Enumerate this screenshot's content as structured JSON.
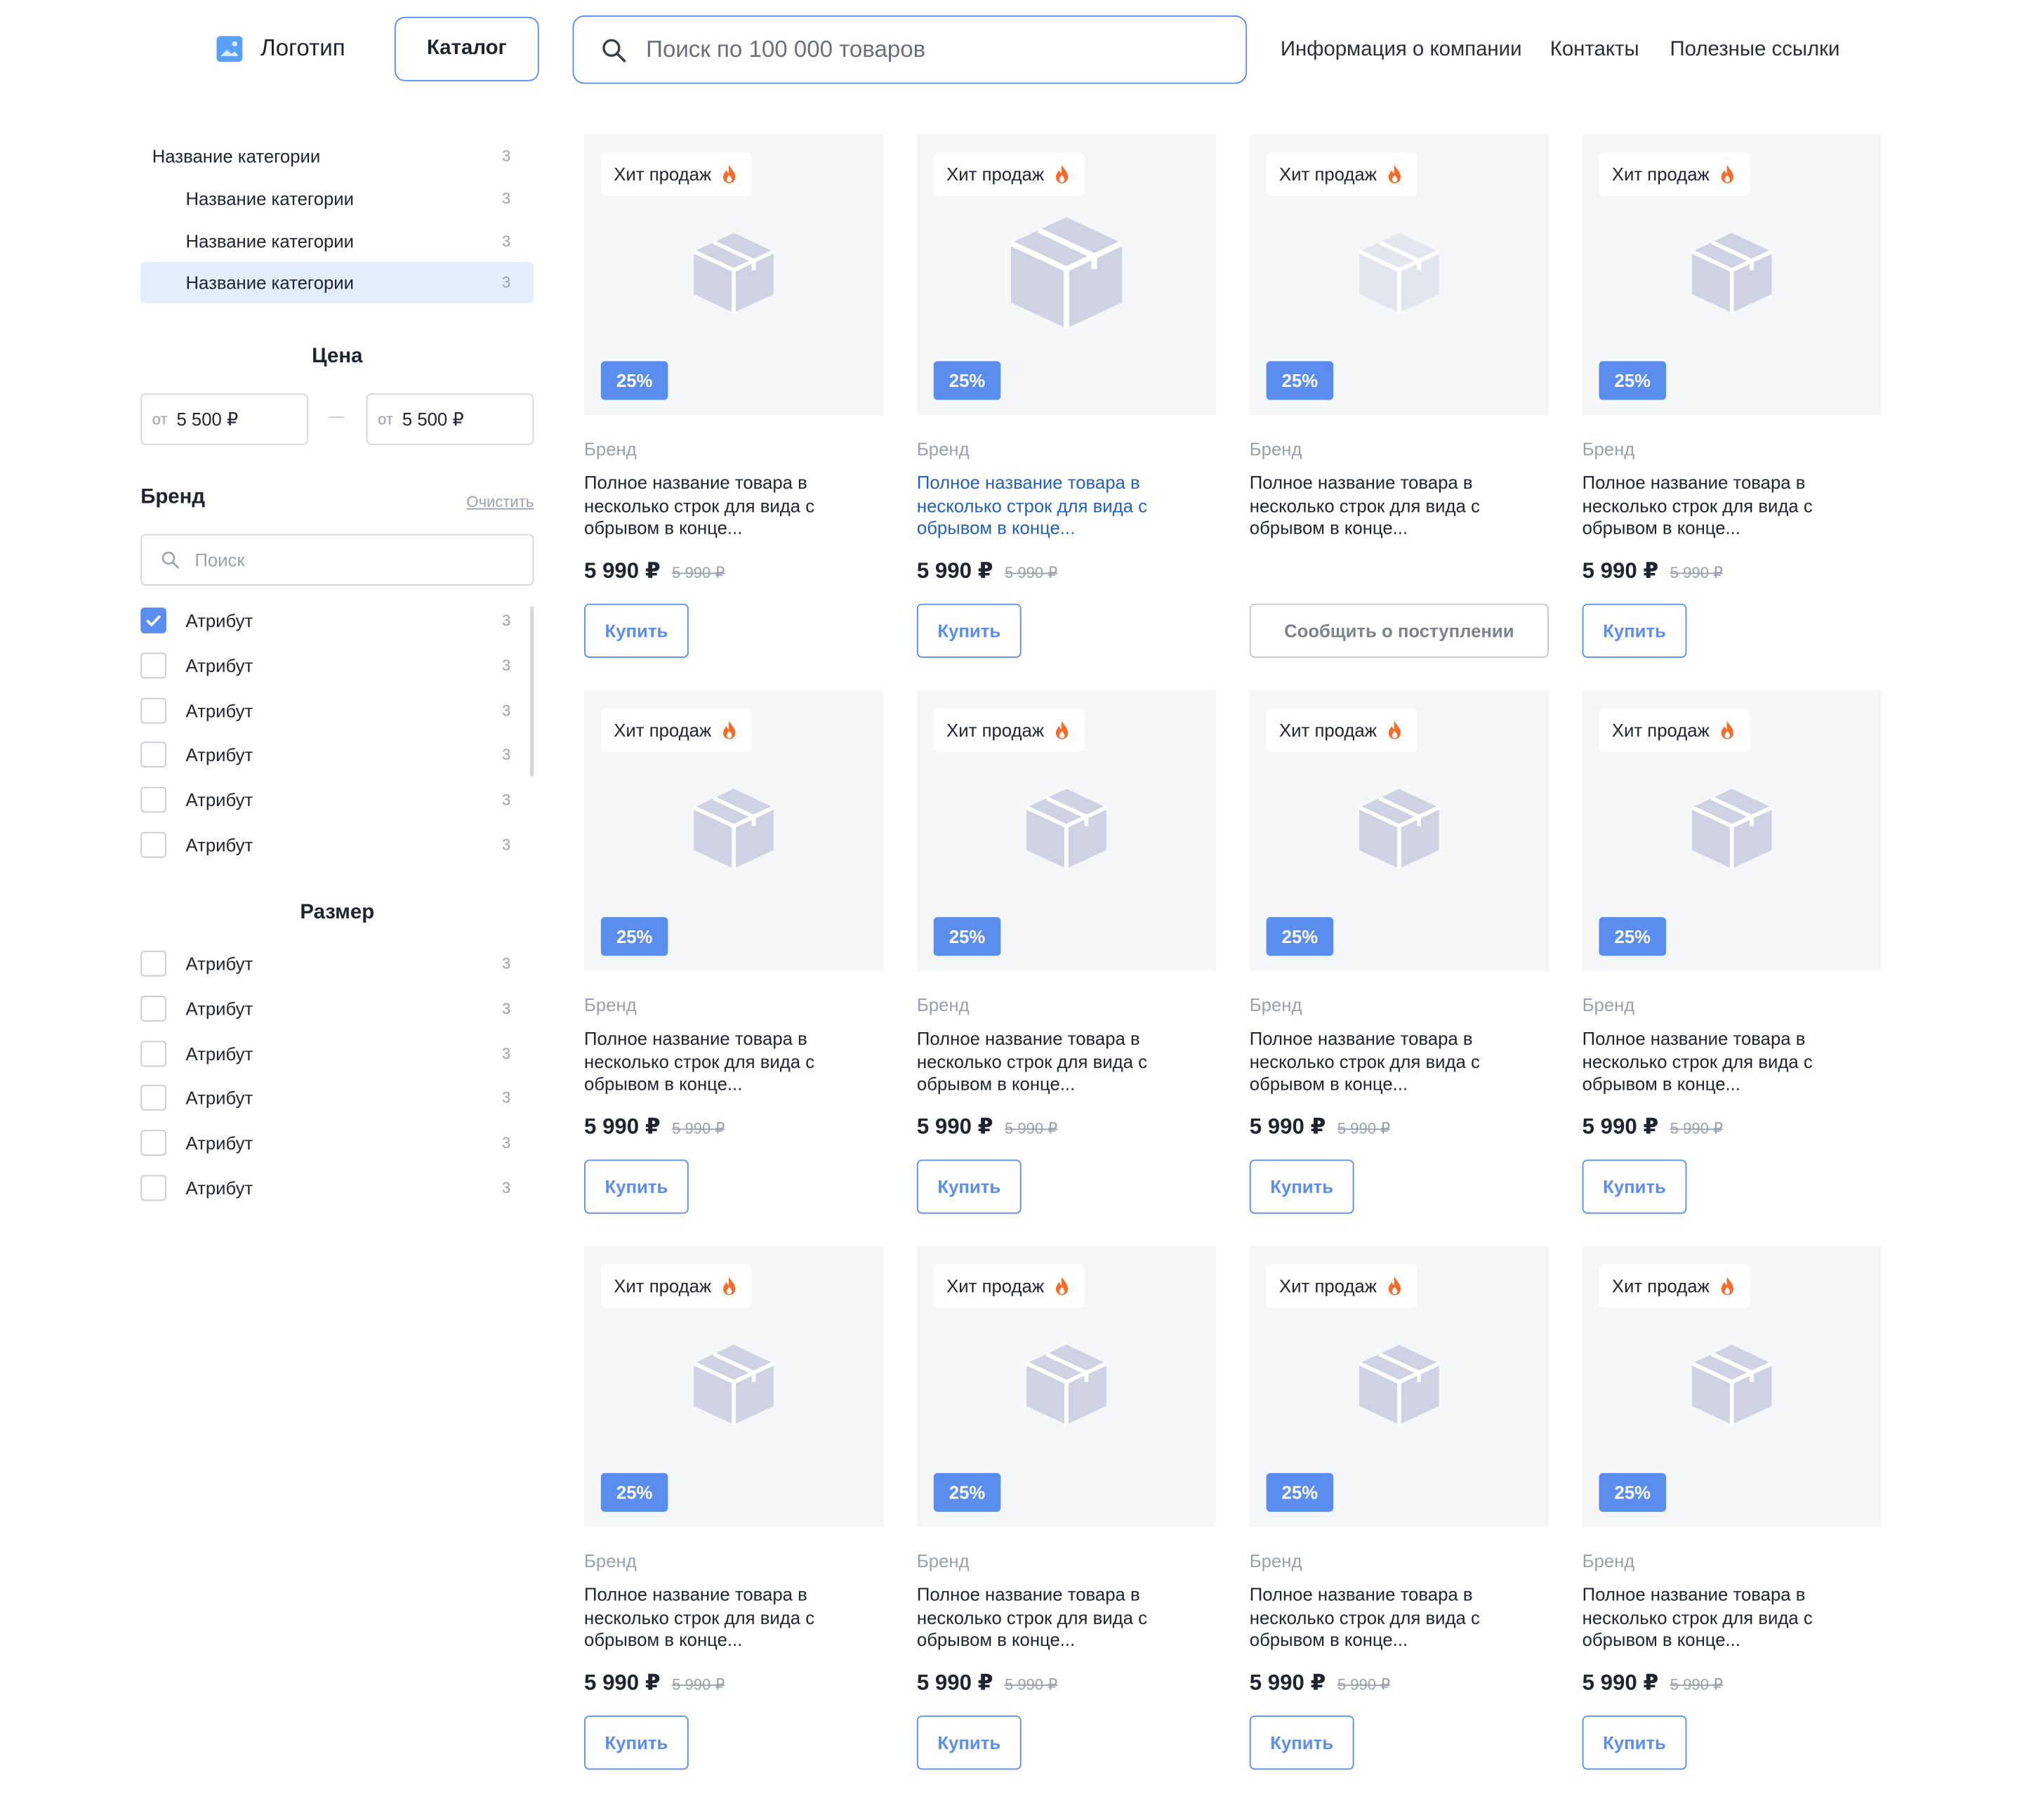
{
  "header": {
    "logo_label": "Логотип",
    "catalog_label": "Каталог",
    "search_placeholder": "Поиск по 100 000 товаров",
    "nav": [
      "Информация о компании",
      "Контакты",
      "Полезные ссылки"
    ]
  },
  "sidebar": {
    "categories": [
      {
        "label": "Название категории",
        "count": "3"
      },
      {
        "label": "Название категории",
        "count": "3"
      },
      {
        "label": "Название категории",
        "count": "3"
      },
      {
        "label": "Название категории",
        "count": "3"
      }
    ],
    "price": {
      "title": "Цена",
      "from_label": "от",
      "from_value": "5 500 ₽",
      "to_label": "от",
      "to_value": "5 500 ₽"
    },
    "brand": {
      "title": "Бренд",
      "clear_label": "Очистить",
      "search_placeholder": "Поиск",
      "items": [
        {
          "label": "Атрибут",
          "count": "3",
          "checked": true
        },
        {
          "label": "Атрибут",
          "count": "3",
          "checked": false
        },
        {
          "label": "Атрибут",
          "count": "3",
          "checked": false
        },
        {
          "label": "Атрибут",
          "count": "3",
          "checked": false
        },
        {
          "label": "Атрибут",
          "count": "3",
          "checked": false
        },
        {
          "label": "Атрибут",
          "count": "3",
          "checked": false
        }
      ]
    },
    "size": {
      "title": "Размер",
      "items": [
        {
          "label": "Атрибут",
          "count": "3",
          "checked": false
        },
        {
          "label": "Атрибут",
          "count": "3",
          "checked": false
        },
        {
          "label": "Атрибут",
          "count": "3",
          "checked": false
        },
        {
          "label": "Атрибут",
          "count": "3",
          "checked": false
        },
        {
          "label": "Атрибут",
          "count": "3",
          "checked": false
        },
        {
          "label": "Атрибут",
          "count": "3",
          "checked": false
        }
      ]
    }
  },
  "products": [
    {
      "badge": "Хит продаж",
      "discount": "25%",
      "brand": "Бренд",
      "name": "Полное название товара в несколько строк для вида с обрывом в конце...",
      "price": "5 990 ₽",
      "old_price": "5 990 ₽",
      "action": "Купить",
      "available": true
    },
    {
      "badge": "Хит продаж",
      "discount": "25%",
      "brand": "Бренд",
      "name": "Полное название товара в несколько строк для вида с обрывом в конце...",
      "price": "5 990 ₽",
      "old_price": "5 990 ₽",
      "action": "Купить",
      "available": true,
      "hovered": true
    },
    {
      "badge": "Хит продаж",
      "discount": "25%",
      "brand": "Бренд",
      "name": "Полное название товара в несколько строк для вида с обрывом в конце...",
      "price": "",
      "old_price": "",
      "action": "Сообщить о поступлении",
      "available": false
    },
    {
      "badge": "Хит продаж",
      "discount": "25%",
      "brand": "Бренд",
      "name": "Полное название товара в несколько строк для вида с обрывом в конце...",
      "price": "5 990 ₽",
      "old_price": "5 990 ₽",
      "action": "Купить",
      "available": true
    },
    {
      "badge": "Хит продаж",
      "discount": "25%",
      "brand": "Бренд",
      "name": "Полное название товара в несколько строк для вида с обрывом в конце...",
      "price": "5 990 ₽",
      "old_price": "5 990 ₽",
      "action": "Купить",
      "available": true
    },
    {
      "badge": "Хит продаж",
      "discount": "25%",
      "brand": "Бренд",
      "name": "Полное название товара в несколько строк для вида с обрывом в конце...",
      "price": "5 990 ₽",
      "old_price": "5 990 ₽",
      "action": "Купить",
      "available": true
    },
    {
      "badge": "Хит продаж",
      "discount": "25%",
      "brand": "Бренд",
      "name": "Полное название товара в несколько строк для вида с обрывом в конце...",
      "price": "5 990 ₽",
      "old_price": "5 990 ₽",
      "action": "Купить",
      "available": true
    },
    {
      "badge": "Хит продаж",
      "discount": "25%",
      "brand": "Бренд",
      "name": "Полное название товара в несколько строк для вида с обрывом в конце...",
      "price": "5 990 ₽",
      "old_price": "5 990 ₽",
      "action": "Купить",
      "available": true
    },
    {
      "badge": "Хит продаж",
      "discount": "25%",
      "brand": "Бренд",
      "name": "Полное название товара в несколько строк для вида с обрывом в конце...",
      "price": "5 990 ₽",
      "old_price": "5 990 ₽",
      "action": "Купить",
      "available": true
    },
    {
      "badge": "Хит продаж",
      "discount": "25%",
      "brand": "Бренд",
      "name": "Полное название товара в несколько строк для вида с обрывом в конце...",
      "price": "5 990 ₽",
      "old_price": "5 990 ₽",
      "action": "Купить",
      "available": true
    },
    {
      "badge": "Хит продаж",
      "discount": "25%",
      "brand": "Бренд",
      "name": "Полное название товара в несколько строк для вида с обрывом в конце...",
      "price": "5 990 ₽",
      "old_price": "5 990 ₽",
      "action": "Купить",
      "available": true
    },
    {
      "badge": "Хит продаж",
      "discount": "25%",
      "brand": "Бренд",
      "name": "Полное название товара в несколько строк для вида с обрывом в конце...",
      "price": "5 990 ₽",
      "old_price": "5 990 ₽",
      "action": "Купить",
      "available": true
    }
  ],
  "colors": {
    "accent": "#5b8def",
    "active_category": "#e2eefc",
    "flame": "#f26d2c",
    "placeholder_bg": "#f5f6f8",
    "hover_link": "#2561b8"
  }
}
